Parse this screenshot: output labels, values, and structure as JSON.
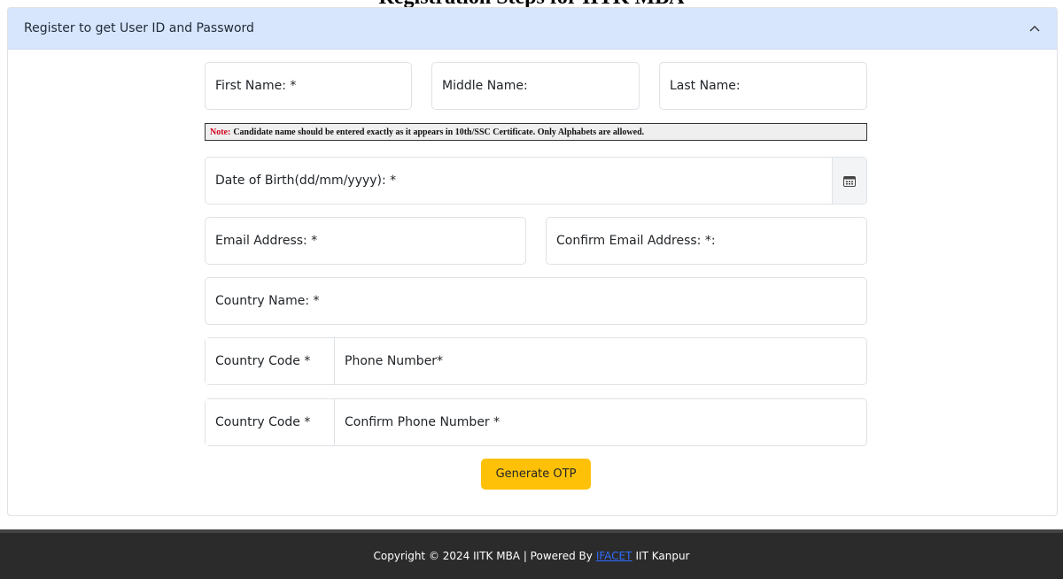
{
  "page_heading_clipped": "Registration Steps for IITK MBA",
  "accordion": {
    "title": "Register to get User ID and Password",
    "chevron_icon": "chevron-up-icon"
  },
  "form": {
    "first_name": "First Name: *",
    "middle_name": "Middle Name:",
    "last_name": "Last Name:",
    "note_label": "Note:",
    "note_text": "Candidate name should be entered exactly as it appears in 10th/SSC Certificate. Only Alphabets are allowed.",
    "dob": "Date of Birth(dd/mm/yyyy): *",
    "calendar_icon": "calendar-icon",
    "email": "Email Address: *",
    "confirm_email": "Confirm Email Address: *:",
    "country_name": "Country Name: *",
    "country_code_1": "Country Code *",
    "phone": "Phone Number*",
    "country_code_2": "Country Code *",
    "confirm_phone": "Confirm Phone Number *",
    "generate_otp": "Generate OTP"
  },
  "footer": {
    "prefix": "Copyright © 2024 IITK MBA | Powered By",
    "link": "IFACET",
    "suffix": "IIT Kanpur"
  },
  "colors": {
    "accordion_bg": "#d7e6fd",
    "otp_button": "#ffc107",
    "footer_bg": "#2b2b2b",
    "link": "#2f6bff",
    "note_label": "#d0021b"
  }
}
